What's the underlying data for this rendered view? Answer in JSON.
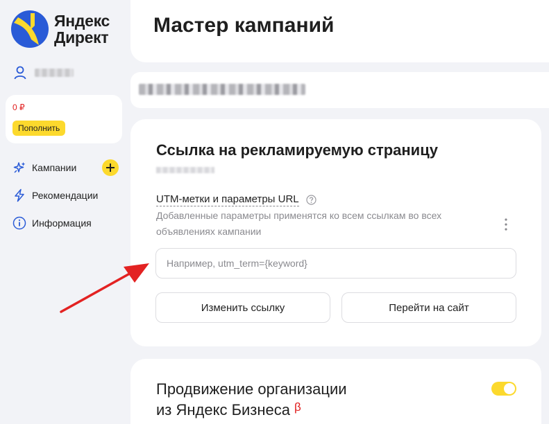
{
  "sidebar": {
    "logo": {
      "line1": "Яндекс",
      "line2": "Директ"
    },
    "balance": {
      "amount": "0 ₽",
      "topup_label": "Пополнить"
    },
    "nav": [
      {
        "label": "Кампании",
        "icon": "sparkle-icon"
      },
      {
        "label": "Рекомендации",
        "icon": "lightning-icon"
      },
      {
        "label": "Информация",
        "icon": "info-icon"
      }
    ]
  },
  "header": {
    "title": "Мастер кампаний"
  },
  "link_card": {
    "title": "Ссылка на рекламируемую страницу",
    "utm_label": "UTM-метки и параметры URL",
    "utm_description": "Добавленные параметры применятся ко всем ссылкам во всех объявлениях кампании",
    "utm_input": {
      "value": "",
      "placeholder": "Например, utm_term={keyword}"
    },
    "change_link_label": "Изменить ссылку",
    "goto_site_label": "Перейти на сайт"
  },
  "org_card": {
    "title_line1": "Продвижение организации",
    "title_line2": "из Яндекс Бизнеса",
    "beta": "β",
    "toggle_on": true
  },
  "colors": {
    "accent_yellow": "#fcd92d",
    "logo_blue": "#2a5bd7",
    "balance_red": "#e01b1b",
    "annotation_arrow": "#e32222",
    "background": "#f2f3f7"
  }
}
